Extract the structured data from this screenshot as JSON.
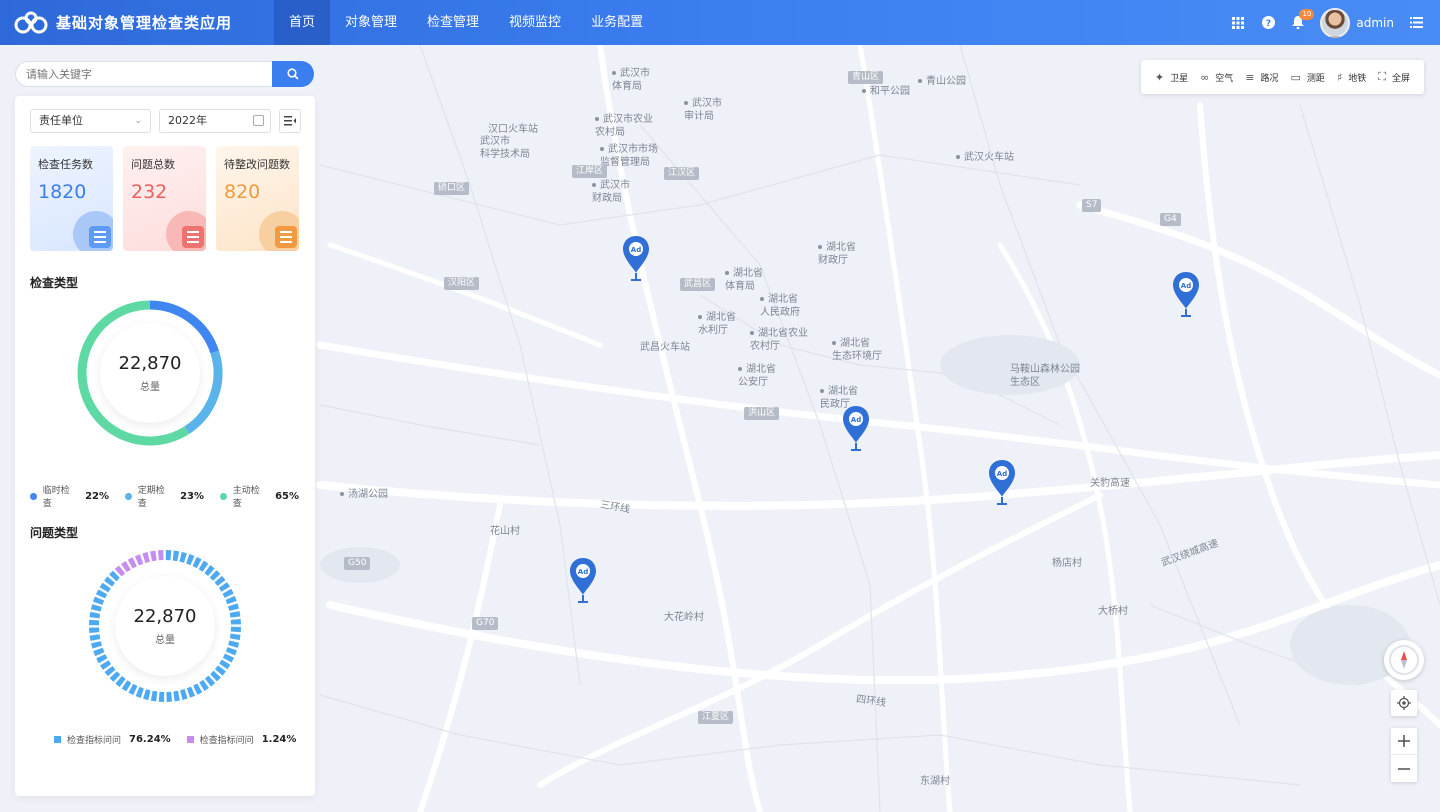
{
  "header": {
    "app_title": "基础对象管理检查类应用",
    "nav": [
      {
        "label": "首页",
        "active": true
      },
      {
        "label": "对象管理",
        "active": false
      },
      {
        "label": "检查管理",
        "active": false
      },
      {
        "label": "视频监控",
        "active": false
      },
      {
        "label": "业务配置",
        "active": false
      }
    ],
    "notification_count": "10",
    "username": "admin",
    "icons": [
      "grid-icon",
      "help-icon",
      "bell-icon",
      "list-menu-icon"
    ]
  },
  "search": {
    "placeholder": "请输入关键字",
    "icon": "search-icon"
  },
  "filters": {
    "unit_select": "责任单位",
    "year": "2022年"
  },
  "stats": [
    {
      "label": "检查任务数",
      "value": "1820",
      "color": "#3b7ef0"
    },
    {
      "label": "问题总数",
      "value": "232",
      "color": "#e9605c"
    },
    {
      "label": "待整改问题数",
      "value": "820",
      "color": "#ef9a3c"
    }
  ],
  "inspection_type": {
    "title": "检查类型",
    "total": "22,870",
    "total_label": "总量",
    "items": [
      {
        "label": "临时检查",
        "pct": "22%",
        "value": 22,
        "color": "#3f86f0"
      },
      {
        "label": "定期检查",
        "pct": "23%",
        "value": 23,
        "color": "#5ab4ea"
      },
      {
        "label": "主动检查",
        "pct": "65%",
        "value": 65,
        "color": "#5fd9a3"
      }
    ]
  },
  "problem_type": {
    "title": "问题类型",
    "total": "22,870",
    "total_label": "总量",
    "items": [
      {
        "label": "检查指标问问",
        "pct": "76.24%",
        "value": 76.24,
        "color": "#4da9f2"
      },
      {
        "label": "检查指标问问",
        "pct": "1.24%",
        "value": 1.24,
        "color": "#c58cf2"
      }
    ]
  },
  "toolbar": [
    {
      "label": "卫星",
      "icon": "satellite-icon"
    },
    {
      "label": "空气",
      "icon": "air-icon"
    },
    {
      "label": "路况",
      "icon": "traffic-icon"
    },
    {
      "label": "测距",
      "icon": "ruler-icon"
    },
    {
      "label": "地铁",
      "icon": "metro-icon"
    },
    {
      "label": "全屏",
      "icon": "fullscreen-icon"
    }
  ],
  "map": {
    "marker_label": "Ad",
    "labels": [
      {
        "text": "武汉市\n体育局"
      },
      {
        "text": "武汉市\n审计局"
      },
      {
        "text": "汉口火车站"
      },
      {
        "text": "武汉市农业\n农村局"
      },
      {
        "text": "武汉市\n科学技术局"
      },
      {
        "text": "武汉市市场\n监督管理局"
      },
      {
        "text": "武汉市\n财政局"
      },
      {
        "text": "武汉火车站"
      },
      {
        "text": "湖北省\n财政厅"
      },
      {
        "text": "湖北省\n体育局"
      },
      {
        "text": "湖北省\n人民政府"
      },
      {
        "text": "湖北省\n水利厅"
      },
      {
        "text": "湖北省农业\n农村厅"
      },
      {
        "text": "湖北省\n生态环境厅"
      },
      {
        "text": "武昌火车站"
      },
      {
        "text": "湖北省\n公安厅"
      },
      {
        "text": "湖北省\n民政厅"
      },
      {
        "text": "马鞍山森林公园\n生态区"
      },
      {
        "text": "汤湖公园"
      },
      {
        "text": "和平公园"
      },
      {
        "text": "青山公园"
      },
      {
        "text": "关豹高速"
      },
      {
        "text": "武汉绕城高速"
      },
      {
        "text": "三环线"
      },
      {
        "text": "四环线"
      },
      {
        "text": "花山村"
      },
      {
        "text": "大花岭村"
      },
      {
        "text": "杨店村"
      },
      {
        "text": "大桥村"
      },
      {
        "text": "东湖村"
      }
    ],
    "districts": [
      "江岸区",
      "江汉区",
      "硚口区",
      "汉阳区",
      "武昌区",
      "洪山区",
      "青山区",
      "江夏区"
    ],
    "road_shields": [
      "G50",
      "G70",
      "S7",
      "G4"
    ]
  }
}
